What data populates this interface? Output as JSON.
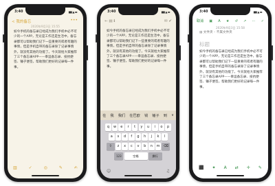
{
  "status_time": "3:40",
  "status_icons": "▮▮▮ ▲ ▬",
  "body_text": "如今手机的备忘录已经成为我们手机中必不可少的一个APP，无论是工作还是生活中，备忘录都可以帮助我们记下一些重要的或者有趣的事情，但是手机自带的备忘录除了记录事情外，就没有其他的功能了。今天就给大家推荐了三个备忘录APP——幸运备忘录、投抗便签、锤子便签，帮助我们更好的记录每一件事。",
  "phone1": {
    "back_label": "< 我的备忘",
    "more_icon": "•••",
    "date": "2020年9月3日 15:55",
    "bottom_icons": [
      "▥",
      "✓",
      "◎",
      "✎",
      "✍"
    ]
  },
  "phone2": {
    "toolbar_left": "← ▤ ℹ",
    "toolbar_right": "✉ ✔",
    "candidates": [
      "在",
      "我",
      "我们",
      "在巴欧",
      "钱",
      "锤子",
      "到",
      "∨"
    ],
    "row1": [
      "q",
      "w",
      "e",
      "r",
      "t",
      "y",
      "u",
      "i",
      "o",
      "p"
    ],
    "row2": [
      "a",
      "s",
      "d",
      "f",
      "g",
      "h",
      "j",
      "k",
      "l"
    ],
    "row3": [
      "⇧",
      "z",
      "x",
      "c",
      "v",
      "b",
      "n",
      "m",
      "⌫"
    ],
    "key_123": "123",
    "key_space": "空格",
    "key_return": "换行",
    "emoji_icon": "☺",
    "mic_icon": "♫"
  },
  "phone3": {
    "toolbar_left": "取消",
    "toolbar_icons": [
      "▣",
      "A",
      "★",
      "↺",
      "↗",
      "⋯"
    ],
    "toolbar_right": "✓",
    "date": "2020年9月3日 15:58",
    "folder": "▤ 文件夹 – 不属文件夹",
    "title_placeholder": "标题",
    "bottom_icons": [
      "⬛",
      "✦",
      "A",
      "⇄",
      "✛",
      "✎"
    ]
  }
}
